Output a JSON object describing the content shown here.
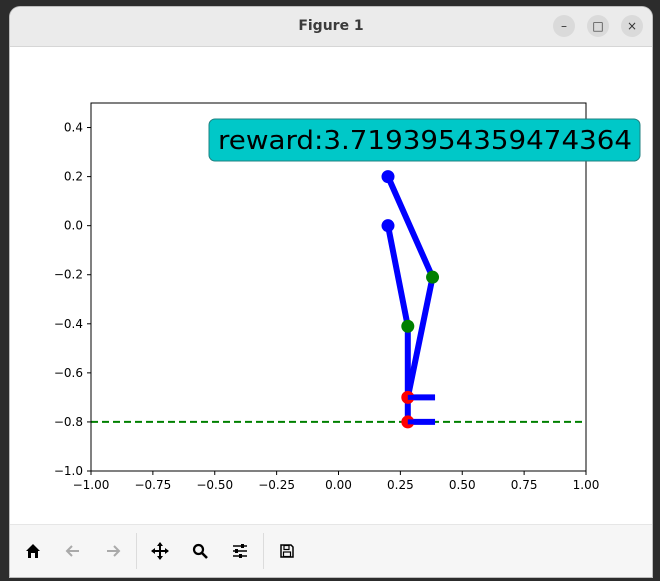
{
  "window": {
    "title": "Figure 1"
  },
  "window_controls": {
    "minimize": "–",
    "maximize": "□",
    "close": "×"
  },
  "toolbar": {
    "items": [
      {
        "icon": "home-icon"
      },
      {
        "icon": "arrow-left-icon"
      },
      {
        "icon": "arrow-right-icon"
      },
      {
        "icon": "move-icon"
      },
      {
        "icon": "zoom-icon"
      },
      {
        "icon": "configure-subplots-icon"
      },
      {
        "icon": "save-icon"
      }
    ]
  },
  "annotation": {
    "text": "reward:3.7193954359474364",
    "bg_color": "#00c8c8"
  },
  "chart_data": {
    "type": "line",
    "xlim": [
      -1.0,
      1.0
    ],
    "ylim": [
      -1.0,
      0.5
    ],
    "xticks": [
      "−1.00",
      "−0.75",
      "−0.50",
      "−0.25",
      "0.00",
      "0.25",
      "0.50",
      "0.75",
      "1.00"
    ],
    "yticks": [
      "−1.0",
      "−0.8",
      "−0.6",
      "−0.4",
      "−0.2",
      "0.0",
      "0.2",
      "0.4"
    ],
    "xtick_values": [
      -1.0,
      -0.75,
      -0.5,
      -0.25,
      0.0,
      0.25,
      0.5,
      0.75,
      1.0
    ],
    "ytick_values": [
      -1.0,
      -0.8,
      -0.6,
      -0.4,
      -0.2,
      0.0,
      0.2,
      0.4
    ],
    "ground_line": {
      "y": -0.8,
      "color": "#008000",
      "style": "dashed"
    },
    "limbs": [
      {
        "points": [
          [
            0.2,
            0.2
          ],
          [
            0.38,
            -0.21
          ],
          [
            0.28,
            -0.7
          ]
        ],
        "color": "#0000ff"
      },
      {
        "points": [
          [
            0.2,
            0.0
          ],
          [
            0.28,
            -0.41
          ],
          [
            0.28,
            -0.8
          ]
        ],
        "color": "#0000ff"
      },
      {
        "points": [
          [
            0.28,
            -0.7
          ],
          [
            0.39,
            -0.7
          ]
        ],
        "color": "#0000ff"
      },
      {
        "points": [
          [
            0.28,
            -0.8
          ],
          [
            0.39,
            -0.8
          ]
        ],
        "color": "#0000ff"
      }
    ],
    "joints": [
      {
        "x": 0.2,
        "y": 0.2,
        "color": "#0000ff"
      },
      {
        "x": 0.2,
        "y": 0.0,
        "color": "#0000ff"
      },
      {
        "x": 0.38,
        "y": -0.21,
        "color": "#008000"
      },
      {
        "x": 0.28,
        "y": -0.41,
        "color": "#008000"
      },
      {
        "x": 0.28,
        "y": -0.7,
        "color": "#ff0000"
      },
      {
        "x": 0.28,
        "y": -0.8,
        "color": "#ff0000"
      }
    ]
  }
}
